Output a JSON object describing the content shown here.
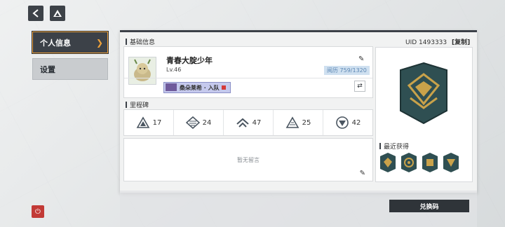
{
  "nav": {
    "back_icon": "back-arrow-icon",
    "logo_icon": "triangle-logo-icon",
    "items": [
      {
        "label": "个人信息",
        "active": true
      },
      {
        "label": "设置",
        "active": false
      }
    ]
  },
  "profile": {
    "section_title": "基础信息",
    "name": "青春大腚少年",
    "level": "Lv.46",
    "exp": "阅历 759/1320",
    "tag": "桑朵莱希 · 入队"
  },
  "milestones": {
    "section_title": "里程碑",
    "items": [
      {
        "icon": "triangle-badge-icon",
        "value": "17"
      },
      {
        "icon": "diamond-lines-badge-icon",
        "value": "24"
      },
      {
        "icon": "chevron-wing-badge-icon",
        "value": "47"
      },
      {
        "icon": "striped-triangle-badge-icon",
        "value": "25"
      },
      {
        "icon": "circle-triangle-badge-icon",
        "value": "42"
      }
    ]
  },
  "message": {
    "empty_text": "暂无留言"
  },
  "uid": {
    "label": "UID",
    "value": "1493333",
    "copy_label": "[复制]"
  },
  "badges": {
    "recent_title": "最近获得"
  },
  "actions": {
    "redeem_label": "兑换码"
  },
  "colors": {
    "accent": "#f0a23a",
    "dark": "#3c4148",
    "badge_teal": "#2f4f52",
    "badge_gold": "#c9a24a"
  }
}
